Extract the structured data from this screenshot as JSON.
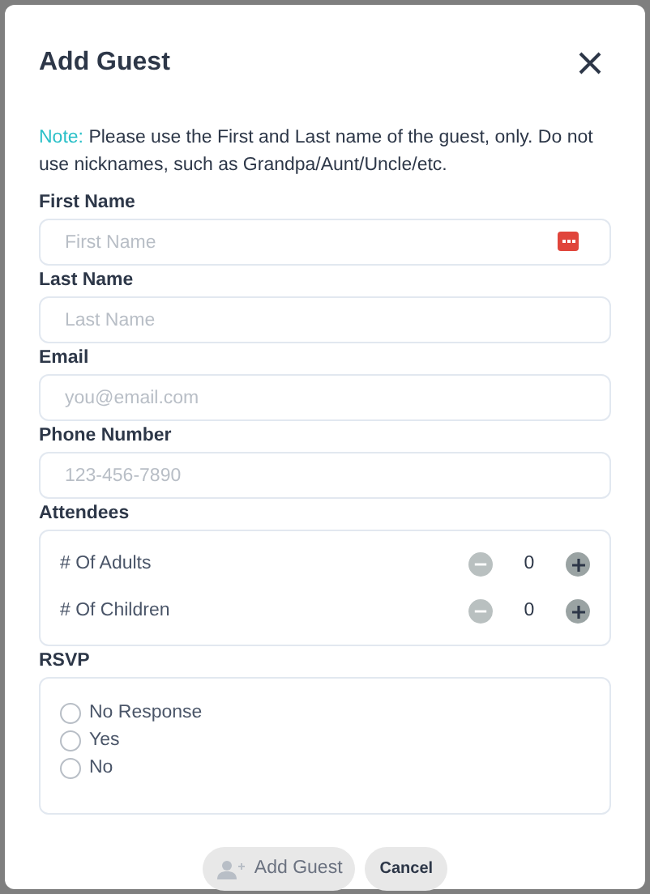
{
  "dialog": {
    "title": "Add Guest",
    "note_label": "Note:",
    "note": "Please use the First and Last name of the guest, only. Do not use nicknames, such as Grandpa/Aunt/Uncle/etc."
  },
  "fields": [
    {
      "label": "First Name",
      "placeholder": "First Name",
      "password_manager_icon": true
    },
    {
      "label": "Last Name",
      "placeholder": "Last Name",
      "password_manager_icon": false
    },
    {
      "label": "Email",
      "placeholder": "you@email.com",
      "password_manager_icon": false
    },
    {
      "label": "Phone Number",
      "placeholder": "123-456-7890",
      "password_manager_icon": false
    }
  ],
  "attendees": {
    "label": "Attendees",
    "counters": [
      {
        "label": "# Of Adults",
        "value": "0",
        "decrement_disabled": true
      },
      {
        "label": "# Of Children",
        "value": "0",
        "decrement_disabled": true
      }
    ]
  },
  "rsvp": {
    "label": "RSVP",
    "options": [
      {
        "label": "No Response",
        "selected": false
      },
      {
        "label": "Yes",
        "selected": false
      },
      {
        "label": "No",
        "selected": false
      }
    ]
  },
  "buttons": [
    {
      "label": "Add Guest",
      "kind": "primary",
      "disabled": true
    },
    {
      "label": "Cancel",
      "kind": "secondary",
      "disabled": false
    }
  ]
}
